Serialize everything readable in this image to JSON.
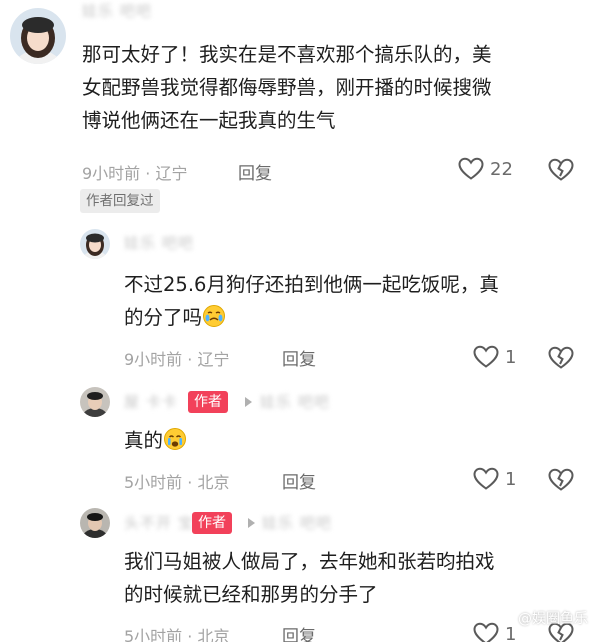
{
  "comments": [
    {
      "username": "娃乐 吧吧",
      "text_line1": "那可太好了！我实在是不喜欢那个搞乐队的，美",
      "text_line2": "女配野兽我觉得都侮辱野兽，刚开播的时候搜微",
      "text_line3": "博说他俩还在一起我真的生气",
      "time_location": "9小时前 · 辽宁",
      "reply_label": "回复",
      "like_count": "22",
      "author_replied": "作者回复过"
    },
    {
      "username": "娃乐 吧吧",
      "text_line1": "不过25.6月狗仔还拍到他俩一起吃饭呢，真",
      "text_line2": "的分了吗",
      "time_location": "9小时前 · 辽宁",
      "reply_label": "回复",
      "like_count": "1"
    },
    {
      "username": "屋 卡卡",
      "author_tag": "作者",
      "reply_to": "娃乐 吧吧",
      "text_line1": "真的",
      "time_location": "5小时前 · 北京",
      "reply_label": "回复",
      "like_count": "1"
    },
    {
      "username": "头不开 宝",
      "author_tag": "作者",
      "reply_to": "娃乐 吧吧",
      "text_line1": "我们马姐被人做局了，去年她和张若昀拍戏",
      "text_line2": "的时候就已经和那男的分手了",
      "time_location": "5小时前 · 北京",
      "reply_label": "回复",
      "like_count": "1"
    }
  ],
  "watermark": "@娱圈鱼乐",
  "colors": {
    "author_tag": "#f2415a",
    "meta": "#a3a3a3",
    "text": "#1e1e1e"
  }
}
